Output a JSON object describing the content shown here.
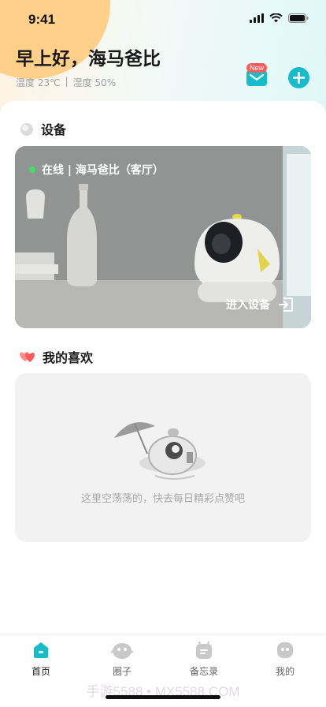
{
  "status_bar": {
    "time": "9:41"
  },
  "header": {
    "greeting": "早上好，海马爸比",
    "temperature": "温度 23℃",
    "separator": "|",
    "humidity": "湿度 50%",
    "badge": "New"
  },
  "devices": {
    "title": "设备",
    "card": {
      "status": "在线 | 海马爸比（客厅）",
      "enter_label": "进入设备"
    }
  },
  "favorites": {
    "title": "我的喜欢",
    "empty_text": "这里空荡荡的，快去每日精彩点赞吧"
  },
  "tabbar": {
    "items": [
      {
        "label": "首页",
        "icon": "home-icon",
        "active": true
      },
      {
        "label": "圈子",
        "icon": "circle-icon",
        "active": false
      },
      {
        "label": "备忘录",
        "icon": "memo-icon",
        "active": false
      },
      {
        "label": "我的",
        "icon": "profile-icon",
        "active": false
      }
    ]
  },
  "watermark": "手游5588 • MX5588.COM",
  "colors": {
    "accent": "#17bcc9",
    "online": "#3ee06b",
    "badge": "#ff5a5a"
  }
}
